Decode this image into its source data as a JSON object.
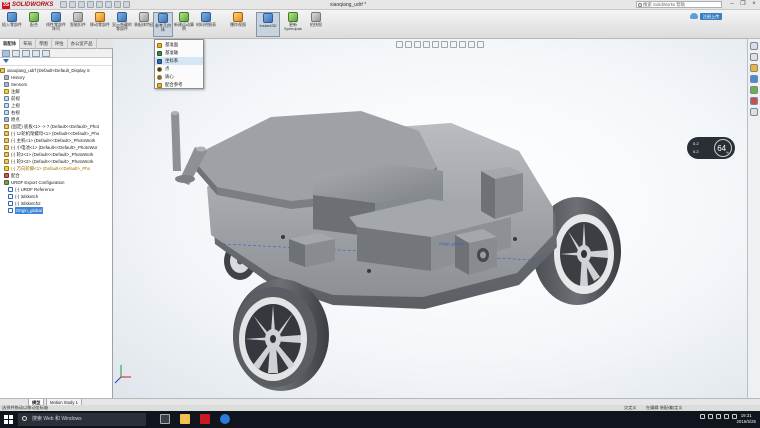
{
  "window": {
    "app_brand": "SOLIDWORKS",
    "document_title": "xiaoqiang_udrf *",
    "search_placeholder": "搜索 SolidWorks 帮助",
    "login_label": "注册上传"
  },
  "ribbon": {
    "buttons": [
      {
        "label": "插入零部件",
        "icon": "insert-component-icon"
      },
      {
        "label": "配合",
        "icon": "mate-icon"
      },
      {
        "label": "线性零部件阵列",
        "icon": "linear-pattern-icon"
      },
      {
        "label": "智能扣件",
        "icon": "smart-fastener-icon"
      },
      {
        "label": "移动零部件",
        "icon": "move-component-icon"
      },
      {
        "label": "显示隐藏的零部件",
        "icon": "show-hidden-icon"
      },
      {
        "label": "装配体特征",
        "icon": "assembly-feature-icon"
      },
      {
        "label": "参考几何体",
        "icon": "reference-geometry-icon"
      },
      {
        "label": "新建运动算例",
        "icon": "motion-study-icon"
      },
      {
        "label": "材料明细表",
        "icon": "bom-icon"
      },
      {
        "label": "爆炸视图",
        "icon": "explode-icon"
      },
      {
        "label": "Instant3D",
        "icon": "instant3d-icon"
      },
      {
        "label": "更新Speedpak",
        "icon": "speedpak-icon"
      },
      {
        "label": "拍快照",
        "icon": "snapshot-icon"
      }
    ]
  },
  "panel_tabs": [
    "装配体",
    "布局",
    "草图",
    "评估",
    "办公室产品"
  ],
  "reference_menu": {
    "items": [
      "基准面",
      "基准轴",
      "坐标系",
      "点",
      "质心",
      "配合参考"
    ]
  },
  "tree": {
    "root": "xiaoqiang_udrf (Default<Default_Display S",
    "items": [
      {
        "label": "History",
        "icon": "history-icon"
      },
      {
        "label": "Sensors",
        "icon": "sensor-icon"
      },
      {
        "label": "注解",
        "icon": "annotation-icon"
      },
      {
        "label": "前视",
        "icon": "plane-icon"
      },
      {
        "label": "上视",
        "icon": "plane-icon"
      },
      {
        "label": "右视",
        "icon": "plane-icon"
      },
      {
        "label": "原点",
        "icon": "origin-icon"
      },
      {
        "label": "(固定) 底板<1> -> ? (Default<<Default>_Phot",
        "icon": "part-icon"
      },
      {
        "label": "(-) 1z轮机架螺母<1> (Default<<Default>_Pho",
        "icon": "part-icon"
      },
      {
        "label": "(-) 主机<1> (Default<<Default>_PhotoWork",
        "icon": "part-icon"
      },
      {
        "label": "(-) 小电池<1> (Default<<Default>_PhotoWor",
        "icon": "part-icon"
      },
      {
        "label": "(-) 轮2<1> (Default<<Default>_PhotoWork",
        "icon": "part-icon"
      },
      {
        "label": "(-) 轮2<2> (Default<<Default>_PhotoWork",
        "icon": "part-icon"
      },
      {
        "label": "(-) 万向轮脚<1> (Default<<Default>_Pho",
        "icon": "warn-icon",
        "light": true
      },
      {
        "label": "配合",
        "icon": "mate-icon"
      },
      {
        "label": "URDF Export Configuration",
        "icon": "urdf-icon"
      },
      {
        "label": "(-) URDF Reference",
        "icon": "sketch-icon"
      },
      {
        "label": "(-) 3dsketch",
        "icon": "sketch-icon"
      },
      {
        "label": "(-) 3dsketch2",
        "icon": "sketch-icon"
      },
      {
        "label": "Origin_global",
        "icon": "sketch-icon",
        "selected": true
      }
    ]
  },
  "viewport": {
    "model_label": "Origin_global",
    "perf_line1": "0.2",
    "perf_line2": "0.2",
    "perf_value": "64",
    "perf_unit": "%"
  },
  "bottom_tabs": [
    "模型",
    "Motion Study 1"
  ],
  "status": {
    "left": "选择并拖动以移动坐标轴",
    "s1": "欠定义",
    "s2": "在编辑 装配体",
    "s3": "自定义"
  },
  "taskbar": {
    "search_placeholder": "搜索 Web 和 Windows",
    "time": "19:31",
    "date": "2016/5/25"
  },
  "colors": {
    "brand_red": "#d0101a",
    "selection_blue": "#3e86d4",
    "model_gray": "#9a9ea3",
    "wheel_dark": "#3b3f44"
  }
}
